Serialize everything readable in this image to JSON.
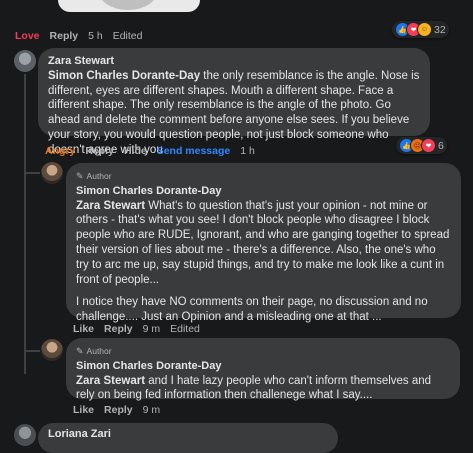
{
  "top_comment": {
    "actions": {
      "love": "Love",
      "reply": "Reply",
      "time": "5 h",
      "edited": "Edited"
    },
    "reaction_count": "32"
  },
  "comment_zara": {
    "author": "Zara Stewart",
    "mention": "Simon Charles Dorante-Day",
    "text": " the only resemblance is the angle. Nose is different, eyes are different shapes. Mouth a different shape. Face a different shape. The only resemblance is the angle of the photo. Go ahead and delete the comment before anyone else sees. If you believe your story, you would question people, not just block someone who doesn't agree with you",
    "actions": {
      "angry": "Angry",
      "reply": "Reply",
      "hide": "Hide",
      "send": "Send message",
      "time": "1 h"
    },
    "reaction_count": "6"
  },
  "reply_1": {
    "badge": "Author",
    "author": "Simon Charles Dorante-Day",
    "mention": "Zara Stewart",
    "text": " What's to question that's just your opinion - not mine or others - that's what you see! I don't block people who disagree I block people who are RUDE, Ignorant, and who are ganging together to spread their version of lies about me - there's a difference. Also, the one's who try to arc me up, say stupid things, and try to make me look like a cunt in front of people...",
    "text2": "I notice they have NO comments on their page, no discussion and no challenge.... Just an Opinion and a misleading one at that ...",
    "actions": {
      "like": "Like",
      "reply": "Reply",
      "time": "9 m",
      "edited": "Edited"
    }
  },
  "reply_2": {
    "badge": "Author",
    "author": "Simon Charles Dorante-Day",
    "mention": "Zara Stewart",
    "text": " and I hate lazy people who can't inform themselves and rely on being fed information then challenege what I say....",
    "actions": {
      "like": "Like",
      "reply": "Reply",
      "time": "9 m"
    }
  },
  "next_comment": {
    "author": "Loriana Zari"
  },
  "icons": [
    "like-icon",
    "love-icon",
    "haha-icon",
    "angry-icon",
    "pencil-icon"
  ],
  "colors": {
    "background": "#18191a",
    "bubble": "#3a3b3c",
    "love": "#f33e58",
    "angry": "#e9710f",
    "link": "#2d88ff"
  }
}
